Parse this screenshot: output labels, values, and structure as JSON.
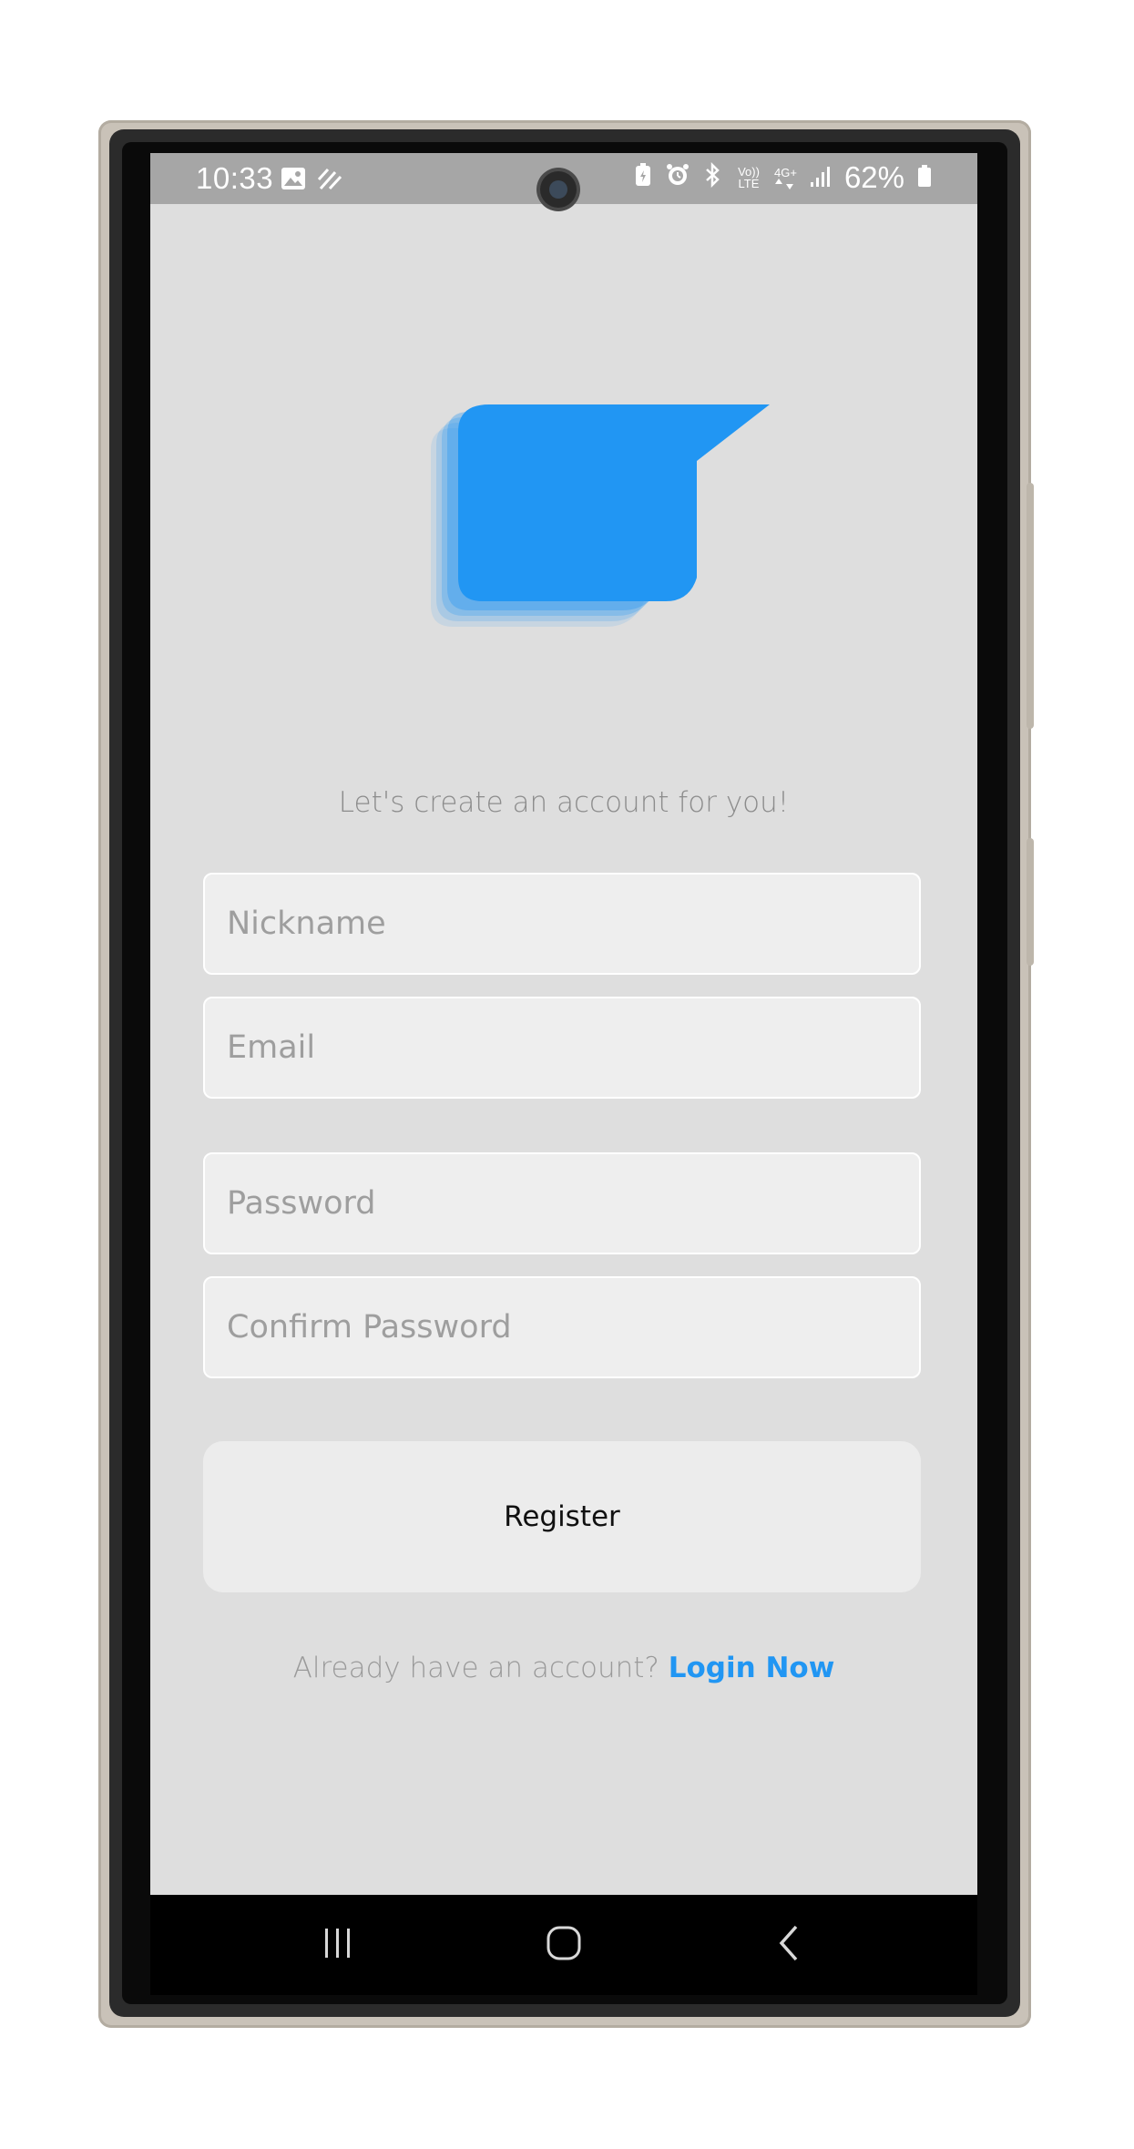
{
  "status_bar": {
    "time": "10:33",
    "battery_percent": "62%",
    "network_type": "4G+",
    "volte_label": "Vo)) LTE",
    "icons_left": [
      "gallery-icon",
      "sync-stripes-icon"
    ],
    "icons_right": [
      "battery-saver-icon",
      "alarm-icon",
      "bluetooth-icon",
      "volte-icon",
      "network-4g-icon",
      "signal-icon",
      "battery-icon"
    ]
  },
  "app": {
    "logo_color": "#2196f3",
    "subtitle": "Let's create an account for you!",
    "fields": {
      "nickname_placeholder": "Nickname",
      "email_placeholder": "Email",
      "password_placeholder": "Password",
      "confirm_password_placeholder": "Confirm Password"
    },
    "register_label": "Register",
    "login_prompt": "Already have an account?",
    "login_link": "Login Now",
    "accent_color": "#2196f3",
    "background_color": "#dedede"
  },
  "nav_bar": {
    "buttons": [
      "recent-apps-icon",
      "home-icon",
      "back-icon"
    ]
  }
}
